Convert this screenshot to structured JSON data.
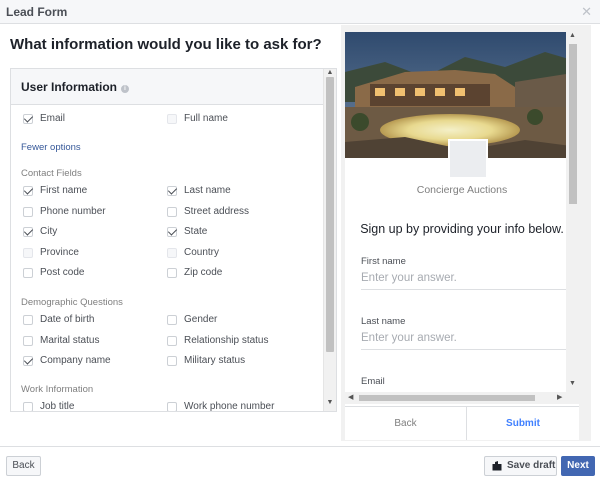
{
  "window": {
    "title": "Lead Form"
  },
  "question": "What information would you like to ask for?",
  "user_info": {
    "header": "User Information",
    "email": "Email",
    "full_name": "Full name",
    "fewer_options": "Fewer options"
  },
  "contact_fields": {
    "label": "Contact Fields",
    "items": [
      {
        "label": "First name",
        "checked": true
      },
      {
        "label": "Last name",
        "checked": true
      },
      {
        "label": "Phone number",
        "checked": false
      },
      {
        "label": "Street address",
        "checked": false
      },
      {
        "label": "City",
        "checked": true
      },
      {
        "label": "State",
        "checked": true
      },
      {
        "label": "Province",
        "checked": false
      },
      {
        "label": "Country",
        "checked": false
      },
      {
        "label": "Post code",
        "checked": false
      },
      {
        "label": "Zip code",
        "checked": false
      }
    ]
  },
  "demographic": {
    "label": "Demographic Questions",
    "items": [
      {
        "label": "Date of birth",
        "checked": false
      },
      {
        "label": "Gender",
        "checked": false
      },
      {
        "label": "Marital status",
        "checked": false
      },
      {
        "label": "Relationship status",
        "checked": false
      },
      {
        "label": "Company name",
        "checked": true
      },
      {
        "label": "Military status",
        "checked": false
      }
    ]
  },
  "work": {
    "label": "Work Information",
    "items": [
      {
        "label": "Job title",
        "checked": false
      },
      {
        "label": "Work phone number",
        "checked": false
      }
    ]
  },
  "preview": {
    "company": "Concierge Auctions",
    "intro": "Sign up by providing your info below.",
    "fields": [
      {
        "label": "First name",
        "placeholder": "Enter your answer."
      },
      {
        "label": "Last name",
        "placeholder": "Enter your answer."
      },
      {
        "label": "Email",
        "placeholder": ""
      }
    ],
    "back": "Back",
    "submit": "Submit"
  },
  "footer": {
    "back": "Back",
    "save_draft": "Save draft",
    "next": "Next"
  },
  "colors": {
    "accent": "#4267b2",
    "link": "#365899",
    "submit": "#4080ff"
  }
}
